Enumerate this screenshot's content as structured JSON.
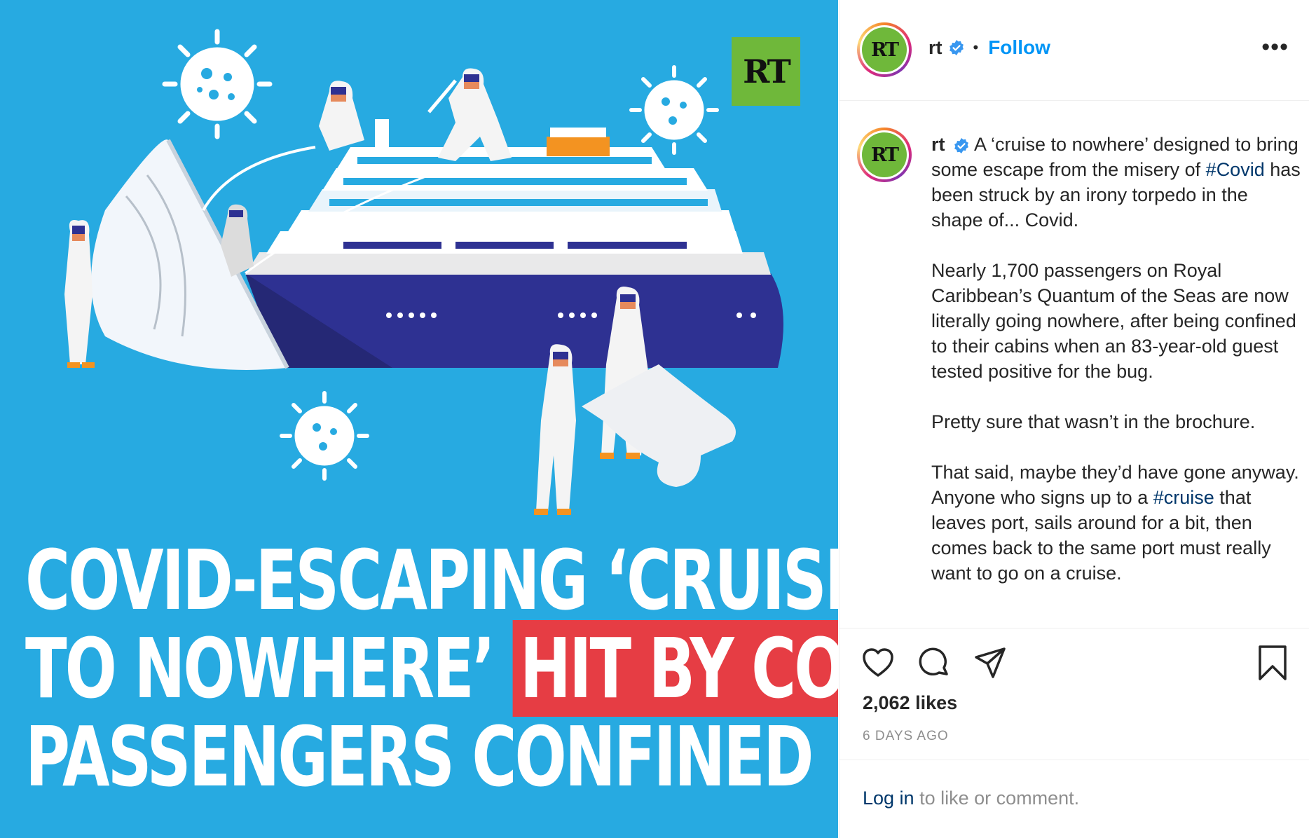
{
  "media": {
    "logo_text": "RT",
    "headline": {
      "line1": "COVID-ESCAPING ‘CRUISE",
      "line2_plain": "TO NOWHERE’",
      "line2_highlight": "HIT BY COVID,",
      "line3": "PASSENGERS CONFINED"
    },
    "colors": {
      "background": "#27aae1",
      "highlight": "#e63d44",
      "logo": "#6fb83a",
      "hull": "#2e3192"
    }
  },
  "header": {
    "avatar_text": "RT",
    "username": "rt",
    "verified": true,
    "separator": "•",
    "follow_label": "Follow",
    "more_label": "•••"
  },
  "caption": {
    "avatar_text": "RT",
    "username": "rt",
    "p1_text": "A ‘cruise to nowhere’ designed to bring some escape from the misery of",
    "p1_hashtag": "#Covid",
    "p1_rest": "has been struck by an irony torpedo in the shape of... Covid.",
    "p2": "Nearly 1,700 passengers on Royal Caribbean’s Quantum of the Seas are now literally going nowhere, after being confined to their cabins when an 83-year-old guest tested positive for the bug.",
    "p3": "Pretty sure that wasn’t in the brochure.",
    "p4_text": "That said, maybe they’d have gone anyway. Anyone who signs up to a",
    "p4_hashtag": "#cruise",
    "p4_rest": "that leaves port, sails around for a bit, then comes back to the same port must really want to go on a cruise."
  },
  "actions": {
    "icons": [
      "heart-icon",
      "comment-icon",
      "share-icon",
      "bookmark-icon"
    ],
    "likes": "2,062 likes",
    "timestamp": "6 DAYS AGO"
  },
  "footer": {
    "login_label": "Log in",
    "rest": "to like or comment."
  },
  "colors": {
    "link": "#0095f6",
    "hashtag": "#00376b",
    "muted": "#8e8e8e",
    "verified": "#3897f0"
  }
}
